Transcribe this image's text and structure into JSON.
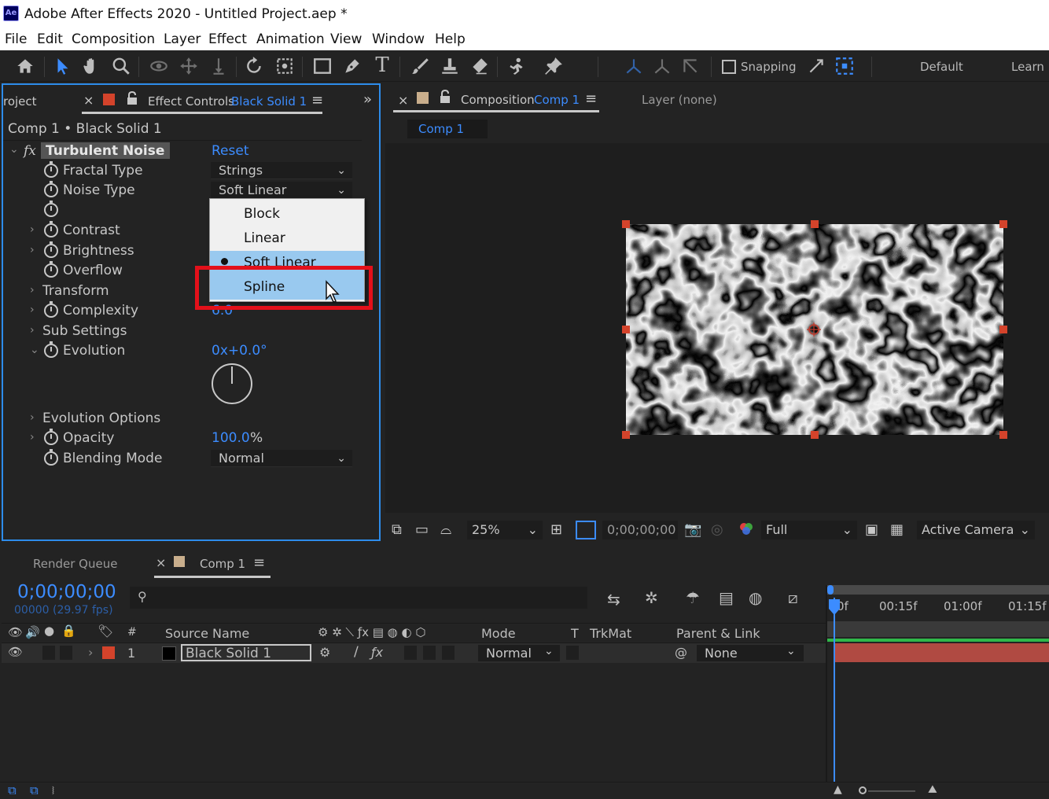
{
  "app": {
    "title": "Adobe After Effects 2020 - Untitled Project.aep *",
    "logo": "Ae"
  },
  "menu": [
    "File",
    "Edit",
    "Composition",
    "Layer",
    "Effect",
    "Animation",
    "View",
    "Window",
    "Help"
  ],
  "toolbar": {
    "snapping_label": "Snapping",
    "workspace": "Default",
    "learn": "Learn",
    "icons": [
      "home-icon",
      "selection-icon",
      "hand-icon",
      "zoom-icon",
      "orbit-icon",
      "pan-icon",
      "dolly-icon",
      "rotate-icon",
      "anchor-icon",
      "rectangle-icon",
      "pen-icon",
      "type-icon",
      "brush-icon",
      "clone-stamp-icon",
      "eraser-icon",
      "roto-brush-icon",
      "puppet-pin-icon"
    ]
  },
  "effect_controls": {
    "project_tab": "roject",
    "tab_label": "Effect Controls",
    "tab_layer": "Black Solid 1",
    "breadcrumb": "Comp 1 • Black Solid 1",
    "effect_name": "Turbulent Noise",
    "fx_label": "fx",
    "reset_label": "Reset",
    "properties": {
      "fractal_type": {
        "label": "Fractal Type",
        "value": "Strings"
      },
      "noise_type": {
        "label": "Noise Type",
        "value": "Soft Linear"
      },
      "contrast": {
        "label": "Contrast"
      },
      "brightness": {
        "label": "Brightness"
      },
      "overflow": {
        "label": "Overflow"
      },
      "transform": {
        "label": "Transform"
      },
      "complexity": {
        "label": "Complexity",
        "value": "6.0"
      },
      "sub_settings": {
        "label": "Sub Settings"
      },
      "evolution": {
        "label": "Evolution",
        "value": "0x+0.0°"
      },
      "evolution_options": {
        "label": "Evolution Options"
      },
      "opacity": {
        "label": "Opacity",
        "value": "100.0",
        "unit": "%"
      },
      "blending_mode": {
        "label": "Blending Mode",
        "value": "Normal"
      }
    },
    "noise_type_menu": {
      "options": [
        "Block",
        "Linear",
        "Soft Linear",
        "Spline"
      ],
      "checked": "Soft Linear",
      "highlighted": "Spline"
    }
  },
  "composition": {
    "tab_label": "Composition",
    "tab_comp": "Comp 1",
    "layer_tab": "Layer (none)",
    "breadcrumb_comp": "Comp 1",
    "viewer": {
      "zoom": "25%",
      "timecode": "0;00;00;00",
      "resolution": "Full",
      "camera": "Active Camera"
    }
  },
  "timeline": {
    "render_queue": "Render Queue",
    "comp_tab": "Comp 1",
    "current_time": "0;00;00;00",
    "frames_fps": "00000 (29.97 fps)",
    "ruler": [
      "0f",
      "00:15f",
      "01:00f",
      "01:15f"
    ],
    "columns": {
      "number": "#",
      "source_name": "Source Name",
      "mode": "Mode",
      "t": "T",
      "trkmat": "TrkMat",
      "parent": "Parent & Link"
    },
    "layers": [
      {
        "number": "1",
        "name": "Black Solid 1",
        "mode": "Normal",
        "parent": "None",
        "label_color": "#d4432b"
      }
    ]
  },
  "colors": {
    "accent": "#3c8cff",
    "highlight_box": "#e3101a",
    "menu_selection": "#99c9ef",
    "layer_bar": "#b04a42"
  }
}
